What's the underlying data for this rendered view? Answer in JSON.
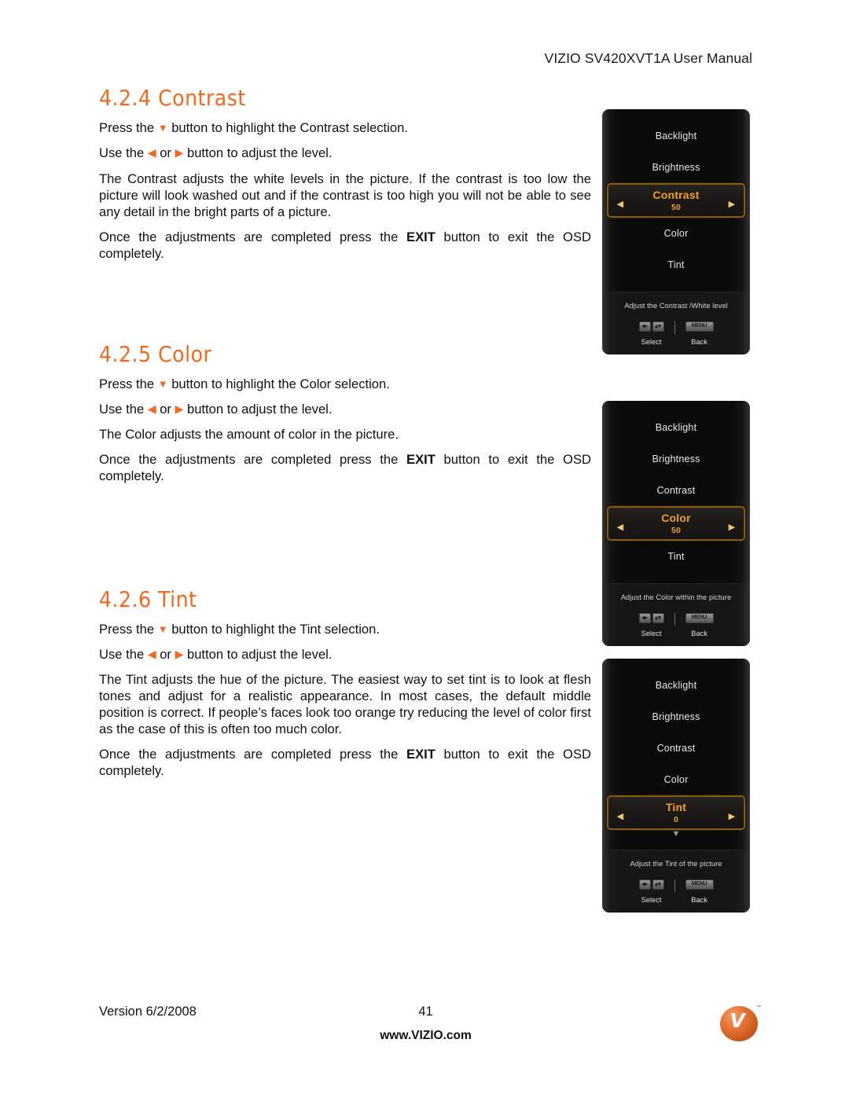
{
  "header": {
    "title": "VIZIO SV420XVT1A User Manual"
  },
  "sections": [
    {
      "id": "contrast",
      "number": "4.2.4",
      "heading": "4.2.4 Contrast",
      "paragraphs": [
        {
          "parts": [
            {
              "t": "text",
              "v": "Press the "
            },
            {
              "t": "tri-down",
              "v": "▼"
            },
            {
              "t": "text",
              "v": " button to highlight the Contrast selection."
            }
          ]
        },
        {
          "parts": [
            {
              "t": "text",
              "v": "Use the "
            },
            {
              "t": "tri-left",
              "v": "◀"
            },
            {
              "t": "text",
              "v": " or "
            },
            {
              "t": "tri-right",
              "v": "▶"
            },
            {
              "t": "text",
              "v": " button to adjust the level."
            }
          ]
        },
        {
          "parts": [
            {
              "t": "text",
              "v": "The Contrast adjusts the white levels in the picture.  If the contrast is too low the picture will look washed out and if the contrast is too high you will not be able to see any detail in the bright parts of a picture."
            }
          ]
        },
        {
          "parts": [
            {
              "t": "text",
              "v": "Once the adjustments are completed press the "
            },
            {
              "t": "bold",
              "v": "EXIT"
            },
            {
              "t": "text",
              "v": " button to exit the OSD completely."
            }
          ]
        }
      ]
    },
    {
      "id": "color",
      "number": "4.2.5",
      "heading": "4.2.5 Color",
      "paragraphs": [
        {
          "parts": [
            {
              "t": "text",
              "v": "Press the "
            },
            {
              "t": "tri-down",
              "v": "▼"
            },
            {
              "t": "text",
              "v": " button to highlight the Color selection."
            }
          ]
        },
        {
          "parts": [
            {
              "t": "text",
              "v": "Use the "
            },
            {
              "t": "tri-left",
              "v": "◀"
            },
            {
              "t": "text",
              "v": " or "
            },
            {
              "t": "tri-right",
              "v": "▶"
            },
            {
              "t": "text",
              "v": " button to adjust the level."
            }
          ]
        },
        {
          "parts": [
            {
              "t": "text",
              "v": "The Color adjusts the amount of color in the picture."
            }
          ]
        },
        {
          "parts": [
            {
              "t": "text",
              "v": "Once the adjustments are completed press the "
            },
            {
              "t": "bold",
              "v": "EXIT"
            },
            {
              "t": "text",
              "v": " button to exit the OSD completely."
            }
          ]
        }
      ]
    },
    {
      "id": "tint",
      "number": "4.2.6",
      "heading": "4.2.6 Tint",
      "paragraphs": [
        {
          "parts": [
            {
              "t": "text",
              "v": "Press the "
            },
            {
              "t": "tri-down",
              "v": "▼"
            },
            {
              "t": "text",
              "v": " button to highlight the Tint selection."
            }
          ]
        },
        {
          "parts": [
            {
              "t": "text",
              "v": "Use the "
            },
            {
              "t": "tri-left",
              "v": "◀"
            },
            {
              "t": "text",
              "v": " or "
            },
            {
              "t": "tri-right",
              "v": "▶"
            },
            {
              "t": "text",
              "v": " button to adjust the level."
            }
          ]
        },
        {
          "parts": [
            {
              "t": "text",
              "v": "The Tint adjusts the hue of the picture.  The easiest way to set tint is to look at flesh tones and adjust for a realistic appearance.  In most cases, the default middle position is correct.  If people’s faces look too orange try reducing the level of color first as the case of this is often too much color."
            }
          ]
        },
        {
          "parts": [
            {
              "t": "text",
              "v": "Once the adjustments are completed press the "
            },
            {
              "t": "bold",
              "v": "EXIT"
            },
            {
              "t": "text",
              "v": " button to exit the OSD completely."
            }
          ]
        }
      ]
    }
  ],
  "osd_menus": [
    {
      "id": "osd-contrast",
      "items": [
        {
          "label": "Backlight",
          "selected": false
        },
        {
          "label": "Brightness",
          "selected": false
        },
        {
          "label": "Contrast",
          "selected": true,
          "value": "50"
        },
        {
          "label": "Color",
          "selected": false
        },
        {
          "label": "Tint",
          "selected": false
        }
      ],
      "scroll_indicator": false,
      "hint": "Adjust the Contrast /White level",
      "keys": {
        "select_label": "Select",
        "back_label": "Back",
        "left_right_key": "◂▸",
        "up_down_key": "▴▾",
        "menu_key": "MENU"
      }
    },
    {
      "id": "osd-color",
      "items": [
        {
          "label": "Backlight",
          "selected": false
        },
        {
          "label": "Brightness",
          "selected": false
        },
        {
          "label": "Contrast",
          "selected": false
        },
        {
          "label": "Color",
          "selected": true,
          "value": "50"
        },
        {
          "label": "Tint",
          "selected": false
        }
      ],
      "scroll_indicator": false,
      "hint": "Adjust the Color within the picture",
      "keys": {
        "select_label": "Select",
        "back_label": "Back",
        "left_right_key": "◂▸",
        "up_down_key": "▴▾",
        "menu_key": "MENU"
      }
    },
    {
      "id": "osd-tint",
      "items": [
        {
          "label": "Backlight",
          "selected": false
        },
        {
          "label": "Brightness",
          "selected": false
        },
        {
          "label": "Contrast",
          "selected": false
        },
        {
          "label": "Color",
          "selected": false
        },
        {
          "label": "Tint",
          "selected": true,
          "value": "0"
        }
      ],
      "scroll_indicator": true,
      "scroll_glyph": "▼",
      "hint": "Adjust the Tint of the picture",
      "keys": {
        "select_label": "Select",
        "back_label": "Back",
        "left_right_key": "◂▸",
        "up_down_key": "▴▾",
        "menu_key": "MENU"
      }
    }
  ],
  "footer": {
    "version": "Version 6/2/2008",
    "page_number": "41",
    "url": "www.VIZIO.com",
    "logo_letter": "V",
    "logo_tm": "™"
  },
  "colors": {
    "accent_orange": "#F4681B",
    "osd_highlight": "#F2A01E",
    "osd_border": "#8A5A13",
    "logo_orange": "#D2601F"
  }
}
